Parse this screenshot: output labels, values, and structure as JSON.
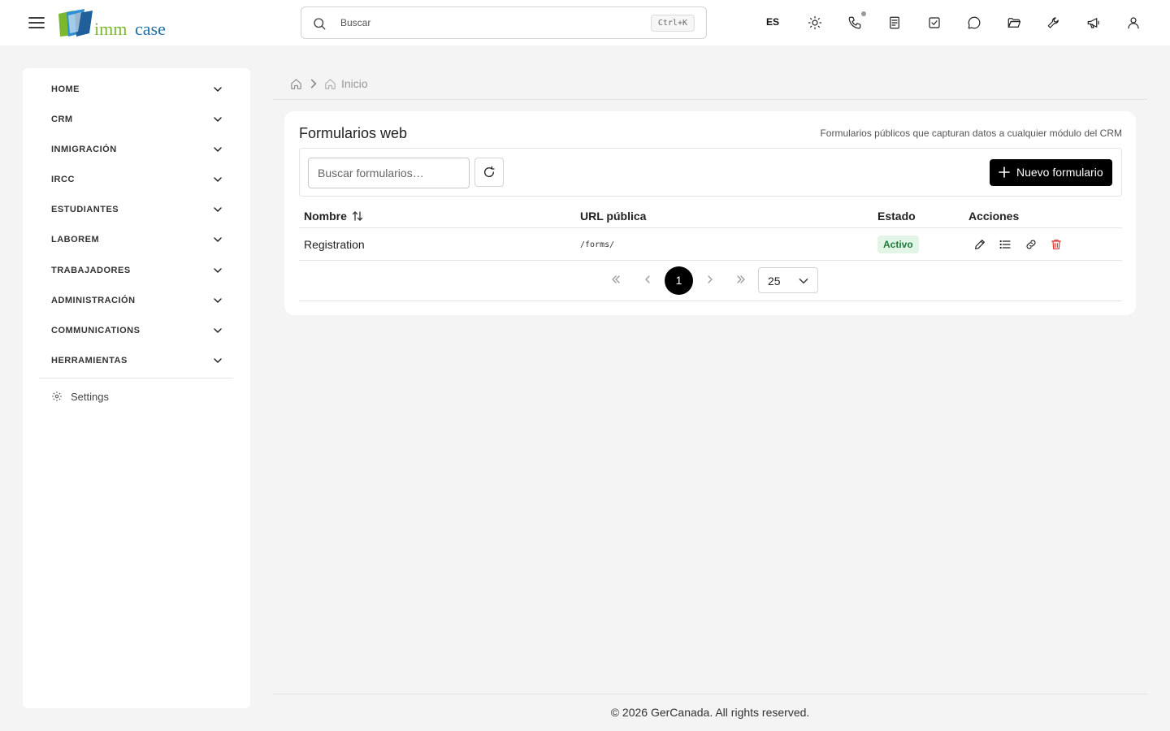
{
  "header": {
    "logo": {
      "text1": "imm",
      "text2": "case",
      "color1": "#7cb82f",
      "color2": "#1f6fa8"
    },
    "search": {
      "placeholder": "Buscar",
      "shortcut": "Ctrl+K"
    },
    "language": "ES",
    "icons": [
      "hamburger-icon",
      "sun-icon",
      "phone-icon",
      "notes-icon",
      "tasks-icon",
      "chat-icon",
      "folder-icon",
      "wrench-icon",
      "megaphone-icon",
      "user-icon"
    ]
  },
  "sidebar": {
    "items": [
      {
        "label": "HOME"
      },
      {
        "label": "CRM"
      },
      {
        "label": "INMIGRACIÓN"
      },
      {
        "label": "IRCC"
      },
      {
        "label": "ESTUDIANTES"
      },
      {
        "label": "LABOREM"
      },
      {
        "label": "TRABAJADORES"
      },
      {
        "label": "ADMINISTRACIÓN"
      },
      {
        "label": "COMMUNICATIONS"
      },
      {
        "label": "HERRAMIENTAS"
      }
    ],
    "settings_label": "Settings"
  },
  "breadcrumb": {
    "current": "Inicio"
  },
  "card": {
    "title": "Formularios web",
    "description": "Formularios públicos que capturan datos a cualquier módulo del CRM",
    "filter_placeholder": "Buscar formularios…",
    "new_button": "Nuevo formulario",
    "columns": {
      "name": "Nombre",
      "url": "URL pública",
      "status": "Estado",
      "actions": "Acciones"
    },
    "rows": [
      {
        "name": "Registration",
        "url": "/forms/",
        "status": "Activo"
      }
    ],
    "pagination": {
      "current_page": "1",
      "page_size": "25"
    },
    "status_colors": {
      "active_bg": "#e3f5e6",
      "active_text": "#1e7b38"
    }
  },
  "footer": {
    "text": "© 2026 GerCanada. All rights reserved."
  }
}
